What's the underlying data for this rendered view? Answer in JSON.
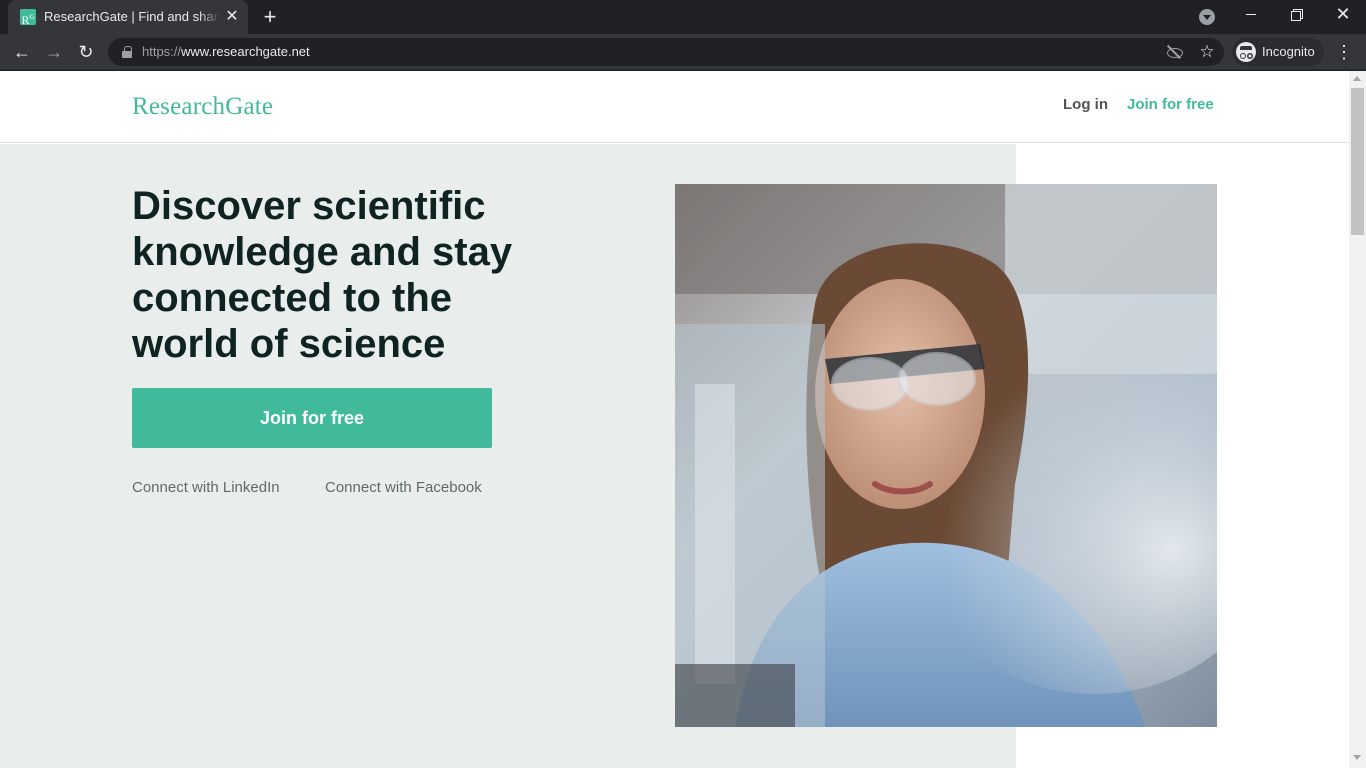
{
  "browser": {
    "tab": {
      "favicon": "R",
      "favicon_sup": "G",
      "title": "ResearchGate | Find and share research",
      "close_glyph": "✕"
    },
    "new_tab_glyph": "+",
    "window": {
      "close_glyph": "✕"
    },
    "nav": {
      "back_glyph": "←",
      "forward_glyph": "→",
      "reload_glyph": "↻"
    },
    "address": {
      "scheme": "https://",
      "host": "www.researchgate.net"
    },
    "star_glyph": "☆",
    "profile_label": "Incognito",
    "menu_glyph": "⋮"
  },
  "site": {
    "logo": "ResearchGate",
    "header": {
      "login": "Log in",
      "join": "Join for free"
    },
    "hero": {
      "title": "Discover scientific knowledge and stay connected to the world of science",
      "cta": "Join for free",
      "linkedin": "Connect with LinkedIn",
      "facebook": "Connect with Facebook"
    }
  },
  "colors": {
    "brand_teal": "#40ba9b",
    "hero_bg": "#e9eeec",
    "heading": "#0f2422"
  }
}
